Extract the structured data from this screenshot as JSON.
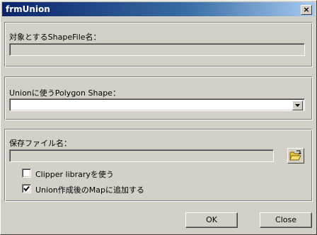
{
  "window": {
    "title": "frmUnion",
    "close_glyph": "×"
  },
  "source_group": {
    "label": "対象とするShapeFile名：",
    "value": ""
  },
  "union_group": {
    "label": "Unionに使うPolygon Shape：",
    "selected": ""
  },
  "save_group": {
    "label": "保存ファイル名：",
    "value": "",
    "browse_icon": "open-folder-icon",
    "clipper": {
      "label": "Clipper libraryを使う",
      "checked": false
    },
    "add_to_map": {
      "label": "Union作成後のMapに追加する",
      "checked": true
    }
  },
  "buttons": {
    "ok": "OK",
    "close": "Close"
  }
}
